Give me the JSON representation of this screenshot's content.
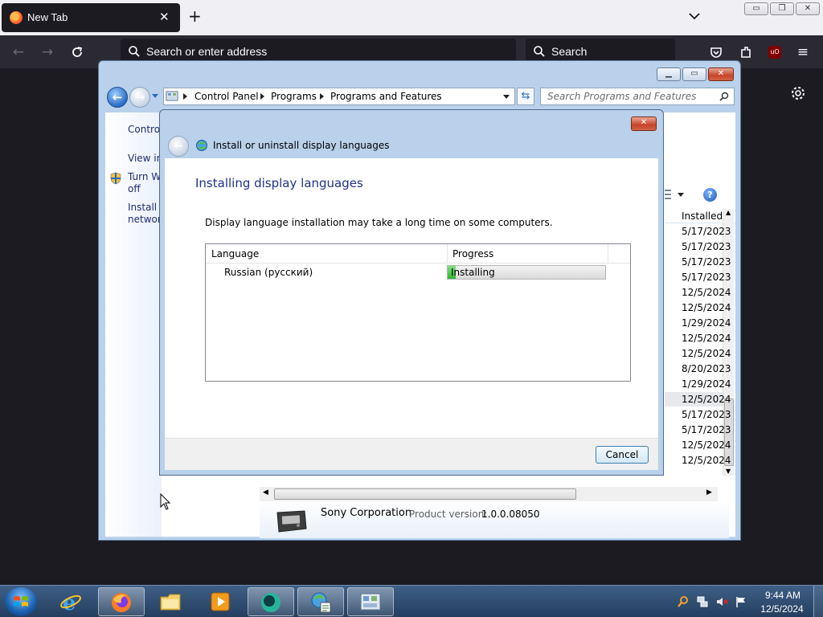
{
  "firefox": {
    "tab_title": "New Tab",
    "tab_close": "✕",
    "new_tab": "+",
    "address_placeholder": "Search or enter address",
    "search_placeholder": "Search",
    "window_minimize": "▭",
    "window_restore": "❐",
    "window_close": "✕"
  },
  "control_panel": {
    "breadcrumbs": [
      "Control Panel",
      "Programs",
      "Programs and Features"
    ],
    "search_placeholder": "Search Programs and Features",
    "left_links": {
      "home": "Control",
      "view": "View in",
      "turn_line1": "Turn W",
      "turn_line2": "off",
      "install_line1": "Install a",
      "install_line2": "network"
    },
    "list": {
      "column_header": "Installed (",
      "dates": [
        "5/17/2023",
        "5/17/2023",
        "5/17/2023",
        "5/17/2023",
        "12/5/2024",
        "12/5/2024",
        "1/29/2024",
        "12/5/2024",
        "12/5/2024",
        "8/20/2023",
        "1/29/2024",
        "12/5/2024",
        "5/17/2023",
        "5/17/2023",
        "12/5/2024",
        "12/5/2024"
      ],
      "selected_index": 11
    },
    "details": {
      "company": "Sony Corporation",
      "product_version_label": "Product version:",
      "product_version": "1.0.0.08050"
    }
  },
  "dialog": {
    "title": "Install or uninstall display languages",
    "heading": "Installing display languages",
    "description": "Display language installation may take a long time on some computers.",
    "columns": {
      "language": "Language",
      "progress": "Progress"
    },
    "rows": [
      {
        "language": "Russian (русский)",
        "status": "Installing",
        "progress": 0.05
      }
    ],
    "cancel_label": "Cancel"
  },
  "taskbar": {
    "time": "9:44 AM",
    "date": "12/5/2024"
  },
  "colors": {
    "accent": "#1e3287",
    "progress_fill": "#2fb52f",
    "firefox_dark": "#1c1b22",
    "aero_frame": "#b9d1ea"
  }
}
